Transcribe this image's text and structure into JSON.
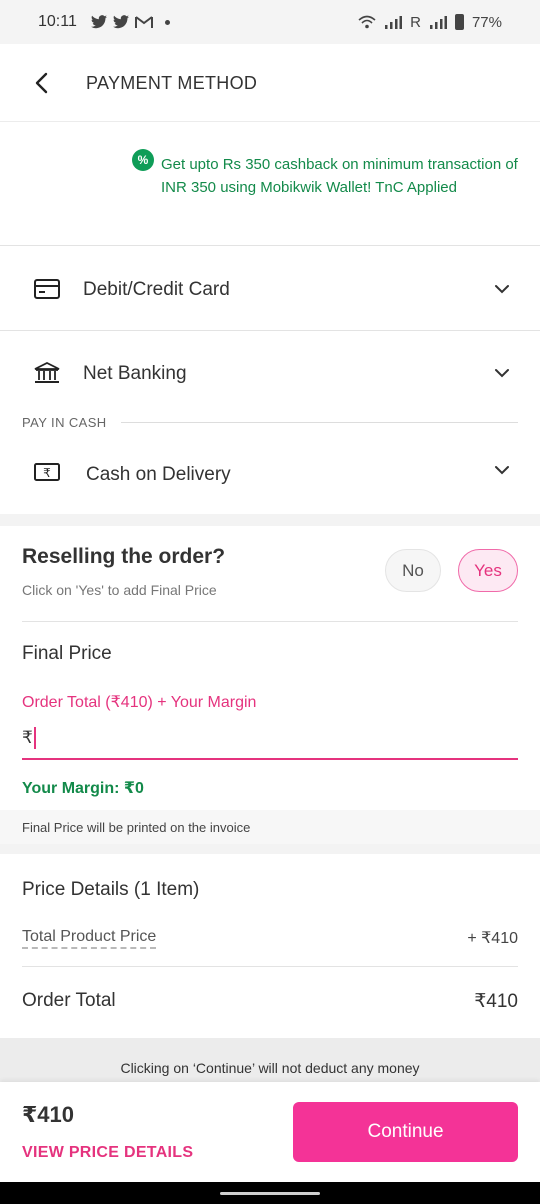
{
  "status_bar": {
    "time": "10:11",
    "notifications": [
      "twitter-icon",
      "twitter-icon",
      "gmail-icon"
    ],
    "network": "R",
    "battery": "77%"
  },
  "header": {
    "title": "PAYMENT METHOD"
  },
  "offer": {
    "icon_text": "%",
    "text": "Get upto Rs 350 cashback on minimum transaction of INR 350 using Mobikwik Wallet! TnC Applied"
  },
  "payment_methods": [
    {
      "label": "Debit/Credit Card",
      "icon": "card-icon"
    },
    {
      "label": "Net Banking",
      "icon": "bank-icon"
    }
  ],
  "pay_in_cash": {
    "section_label": "PAY IN CASH",
    "option": {
      "label": "Cash on Delivery",
      "icon": "cash-icon"
    }
  },
  "resell": {
    "title": "Reselling the order?",
    "subtitle": "Click on 'Yes' to add Final Price",
    "no_label": "No",
    "yes_label": "Yes",
    "selected": "Yes"
  },
  "final_price": {
    "title": "Final Price",
    "input_label": "Order Total (₹410) + Your Margin",
    "prefix": "₹",
    "value": "",
    "margin": "Your Margin: ₹0",
    "invoice_note": "Final Price will be printed on the invoice"
  },
  "price_details": {
    "title": "Price Details (1 Item)",
    "total_product_price_label": "Total Product Price",
    "total_product_price_value": "+ ₹410",
    "order_total_label": "Order Total",
    "order_total_value": "₹410"
  },
  "continue_note": "Clicking on ‘Continue’ will not deduct any money",
  "footer": {
    "amount": "₹410",
    "view_details": "VIEW PRICE DETAILS",
    "continue_label": "Continue"
  },
  "colors": {
    "accent_pink": "#f43397",
    "text_pink": "#e5337e",
    "success_green": "#138a4a"
  }
}
